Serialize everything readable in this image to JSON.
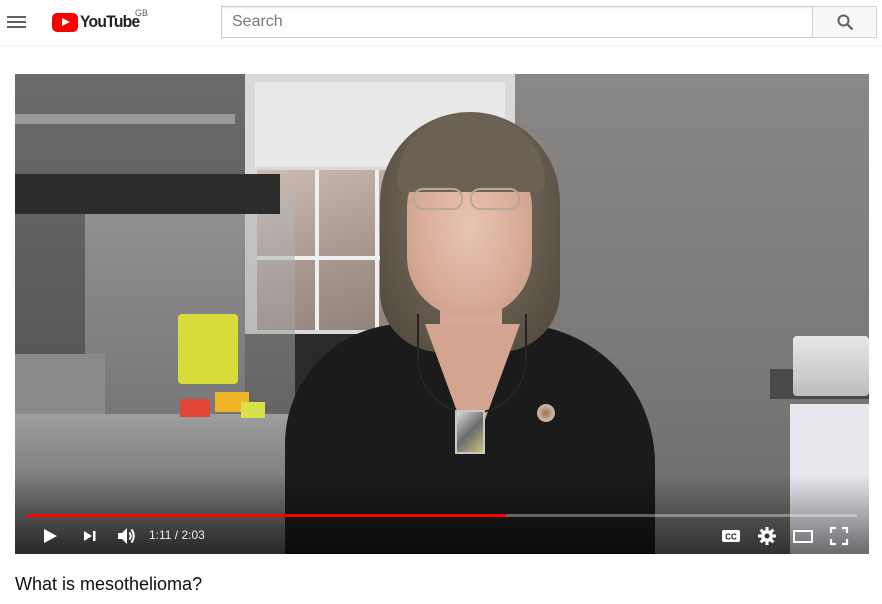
{
  "header": {
    "logo_text": "YouTube",
    "country_code": "GB",
    "search_placeholder": "Search"
  },
  "player": {
    "current_time": "1:11",
    "duration": "2:03",
    "time_display": "1:11 / 2:03",
    "progress_fraction": 0.577,
    "accent_color": "#ff0000"
  },
  "video": {
    "title": "What is mesothelioma?"
  },
  "icons": [
    "menu-icon",
    "youtube-logo-icon",
    "search-icon",
    "play-icon",
    "next-icon",
    "volume-icon",
    "subtitles-icon",
    "settings-icon",
    "theater-mode-icon",
    "fullscreen-icon"
  ]
}
